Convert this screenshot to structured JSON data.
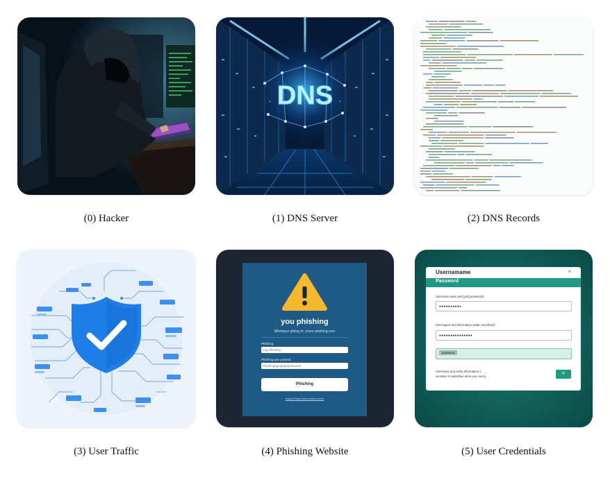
{
  "captions": {
    "c0": "(0) Hacker",
    "c1": "(1) DNS Server",
    "c2": "(2) DNS Records",
    "c3": "(3) User Traffic",
    "c4": "(4) Phishing Website",
    "c5": "(5) User Credentials"
  },
  "dns_server": {
    "sign": "DNS"
  },
  "phishing": {
    "title": "you phishing",
    "subtitle": "Whshrpur phiing of, yours phishing.com",
    "field1_label": "Phishing",
    "field1_placeholder": "Log Phishing",
    "field2_label": "Phishing pon yoremd",
    "field2_placeholder": "Phishinghgmgkgnpassword",
    "button": "Phishing",
    "footer_link": "www.phhhgmhshorwphnoncom"
  },
  "credentials": {
    "title": "Usernamame",
    "tab": "Password",
    "close": "×",
    "label1": "Username ation and (prfg password)",
    "value1": "●●●●●●●●●●",
    "label2": "Usernapert and information wattin sensitive]?",
    "value2": "●●●●●●●●●●●●●●●",
    "highlight_tag": "password",
    "note_line1": "Username and sehty information s",
    "note_line2": "sensitive in passiblue ation you menry",
    "ok_button": "✕"
  },
  "colors": {
    "hacker_bg": "#0b1620",
    "dns_glow": "#5fd3ff",
    "traffic_blue": "#1f7ee8",
    "phishing_bg": "#1c2733",
    "phishing_panel": "#1e5a85",
    "warning": "#f5b82e",
    "cred_teal": "#1e9a84"
  }
}
